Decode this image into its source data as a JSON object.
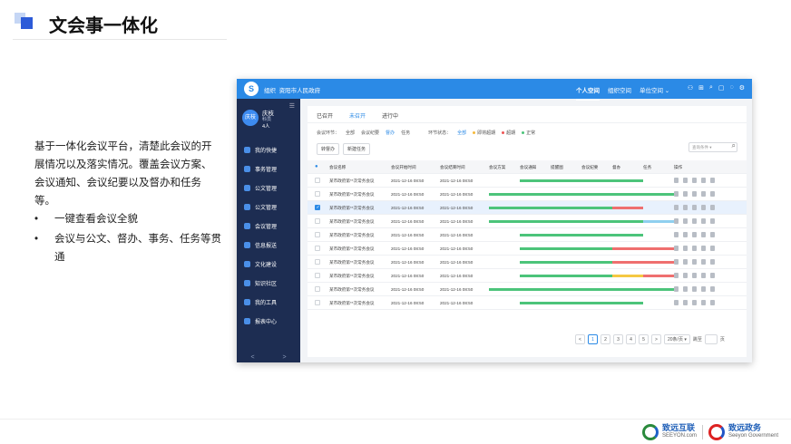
{
  "slide": {
    "title": "文会事一体化",
    "description": "基于一体化会议平台，清楚此会议的开展情况以及落实情况。覆盖会议方案、会议通知、会议纪要以及督办和任务等。",
    "bullets": [
      "一键查看会议全貌",
      "会议与公文、督办、事务、任务等贯通"
    ],
    "footer": {
      "brand1": "致远互联",
      "brand1_sub": "SEEYON.com",
      "brand2": "致远政务",
      "brand2_sub": "Seeyon Government"
    }
  },
  "app": {
    "header": {
      "logo": "S",
      "org_label": "组织",
      "org_name": "资阳市人民政府",
      "spaces": [
        "个人空间",
        "组织空间",
        "单位空间"
      ],
      "active_space": 0
    },
    "user": {
      "avatar_text": "庆枝",
      "name": "庆枝",
      "role": "科员",
      "count": "4人"
    },
    "sidebar_items": [
      "我的快捷",
      "事务管理",
      "公文管理",
      "公文管理",
      "会议管理",
      "信息报送",
      "文化建设",
      "知识社区",
      "我的工具",
      "报表中心"
    ],
    "sidebar_nav": {
      "prev": "<",
      "next": ">"
    },
    "tabs": [
      "已召开",
      "未召开",
      "进行中"
    ],
    "active_tab": 1,
    "filters": {
      "stage_label": "会议环节：",
      "stage_options": [
        "全部",
        "会议纪要",
        "督办",
        "任务"
      ],
      "stage_active": 2,
      "status_label": "环节状态：",
      "status_options": [
        {
          "label": "全部",
          "color": "#2b8ae6"
        },
        {
          "label": "即将超期",
          "color": "#f5b93b"
        },
        {
          "label": "超期",
          "color": "#e55"
        },
        {
          "label": "正常",
          "color": "#4cc47a"
        }
      ]
    },
    "buttons": {
      "transfer": "转督办",
      "new_task": "新建任务"
    },
    "search": {
      "placeholder": "查询条件",
      "dropdown": "▾",
      "icon": "⌕"
    },
    "table": {
      "columns": [
        "会议名称",
        "会议开始时间",
        "会议结束时间",
        "会议方案",
        "会议通知",
        "提醒图",
        "会议纪要",
        "督办",
        "任务",
        "操作"
      ],
      "rows": [
        {
          "name": "某市政府第**次常务会议",
          "start": "2021-12-16 08:50",
          "end": "2021-12-16 08:50",
          "selected": false
        },
        {
          "name": "某市政府第**次常务会议",
          "start": "2021-12-16 08:50",
          "end": "2021-12-16 08:50",
          "selected": false
        },
        {
          "name": "某市政府第**次常务会议",
          "start": "2021-12-16 08:50",
          "end": "2021-12-16 08:50",
          "selected": true
        },
        {
          "name": "某市政府第**次常务会议",
          "start": "2021-12-16 08:50",
          "end": "2021-12-16 08:50",
          "selected": false
        },
        {
          "name": "某市政府第**次常务会议",
          "start": "2021-12-16 08:50",
          "end": "2021-12-16 08:50",
          "selected": false
        },
        {
          "name": "某市政府第**次常务会议",
          "start": "2021-12-16 08:50",
          "end": "2021-12-16 08:50",
          "selected": false
        },
        {
          "name": "某市政府第**次常务会议",
          "start": "2021-12-16 08:50",
          "end": "2021-12-16 08:50",
          "selected": false
        },
        {
          "name": "某市政府第**次常务会议",
          "start": "2021-12-16 08:50",
          "end": "2021-12-16 08:50",
          "selected": false
        },
        {
          "name": "某市政府第**次常务会议",
          "start": "2021-12-16 08:50",
          "end": "2021-12-16 08:50",
          "selected": false
        },
        {
          "name": "某市政府第**次常务会议",
          "start": "2021-12-16 08:50",
          "end": "2021-12-16 08:50",
          "selected": false
        }
      ],
      "progress": [
        [
          {
            "from": 4,
            "to": 8,
            "color": "#4cc47a"
          }
        ],
        [
          {
            "from": 3,
            "to": 9,
            "color": "#4cc47a"
          }
        ],
        [
          {
            "from": 3,
            "to": 7,
            "color": "#4cc47a"
          },
          {
            "from": 7,
            "to": 8,
            "color": "#ef6f6f"
          }
        ],
        [
          {
            "from": 3,
            "to": 8,
            "color": "#4cc47a"
          },
          {
            "from": 8,
            "to": 9,
            "color": "#8fcfef"
          }
        ],
        [
          {
            "from": 4,
            "to": 8,
            "color": "#4cc47a"
          }
        ],
        [
          {
            "from": 4,
            "to": 7,
            "color": "#4cc47a"
          },
          {
            "from": 7,
            "to": 9,
            "color": "#ef6f6f"
          }
        ],
        [
          {
            "from": 4,
            "to": 7,
            "color": "#4cc47a"
          },
          {
            "from": 7,
            "to": 9,
            "color": "#ef6f6f"
          }
        ],
        [
          {
            "from": 4,
            "to": 7,
            "color": "#4cc47a"
          },
          {
            "from": 7,
            "to": 8,
            "color": "#f5c842"
          },
          {
            "from": 8,
            "to": 9,
            "color": "#ef6f6f"
          }
        ],
        [
          {
            "from": 3,
            "to": 9,
            "color": "#4cc47a"
          }
        ],
        [
          {
            "from": 4,
            "to": 8,
            "color": "#4cc47a"
          }
        ]
      ]
    },
    "pagination": {
      "prev": "<",
      "pages": [
        "1",
        "2",
        "3",
        "4",
        "5"
      ],
      "active": 0,
      "next": ">",
      "page_size": "20条/页 ▾",
      "goto_label": "跳至",
      "page_suffix": "页"
    }
  }
}
